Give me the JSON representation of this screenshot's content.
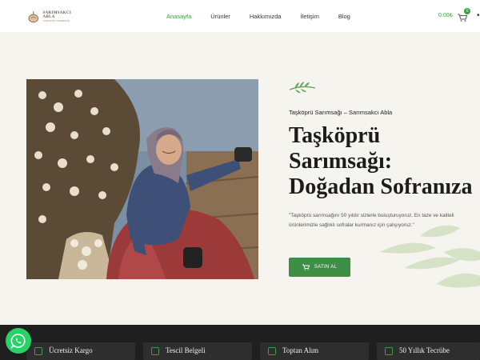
{
  "header": {
    "logo_name": "SARIMSAKCI ABLA",
    "logo_sub": "TAŞKÖPRÜ SARIMSAĞI",
    "nav": [
      "Anasayfa",
      "Ürünler",
      "Hakkımızda",
      "İletişim",
      "Blog"
    ],
    "active_nav": "Anasayfa",
    "cart_amount": "0.00₺",
    "cart_count": "0"
  },
  "hero": {
    "eyebrow": "Taşköprü Sarımsağı – Sarımsakcı Abla",
    "title_line1": "Taşköprü",
    "title_line2": "Sarımsağı:",
    "title_line3": "Doğadan Sofranıza",
    "description": "\"Taşköprü sarımsağını 50 yıldır sizlerle buluşturuyoruz. En taze ve kaliteli ürünlerimizle sağlıklı sofralar kurmanız için çalışıyoruz.\"",
    "buy_label": "SATIN AL"
  },
  "features": [
    "Ücretsiz Kargo",
    "Tescil Belgeli",
    "Toptan Alım",
    "50 Yıllık Tecrübe"
  ],
  "colors": {
    "accent": "#3e9b48",
    "dark_bar": "#1f1f1f",
    "background": "#f5f4ef"
  }
}
